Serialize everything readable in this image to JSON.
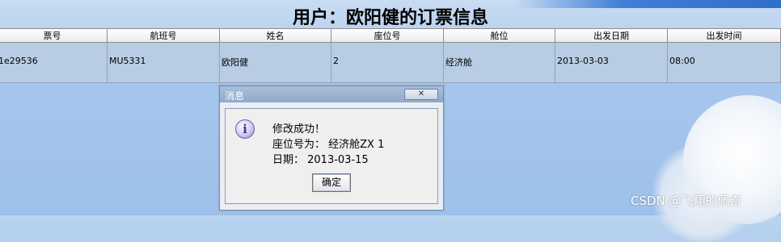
{
  "page": {
    "title": "用户：欧阳健的订票信息"
  },
  "table": {
    "headers": [
      "票号",
      "航班号",
      "姓名",
      "座位号",
      "舱位",
      "出发日期",
      "出发时间"
    ],
    "rows": [
      [
        "1e29536",
        "MU5331",
        "欧阳健",
        "2",
        "经济舱",
        "2013-03-03",
        "08:00"
      ]
    ]
  },
  "dialog": {
    "title": "消息",
    "close_glyph": "✕",
    "icon": "information-icon",
    "line1": "修改成功！",
    "line2": "座位号为： 经济舱ZX 1",
    "line3": "日期： 2013-03-15",
    "ok_label": "确定"
  },
  "watermark": "CSDN @飞翔的佩奇",
  "colors": {
    "background": "#a6c6ec",
    "table_row_bg": "#b8cde4",
    "dialog_title_bg": "#8ea9ca"
  }
}
